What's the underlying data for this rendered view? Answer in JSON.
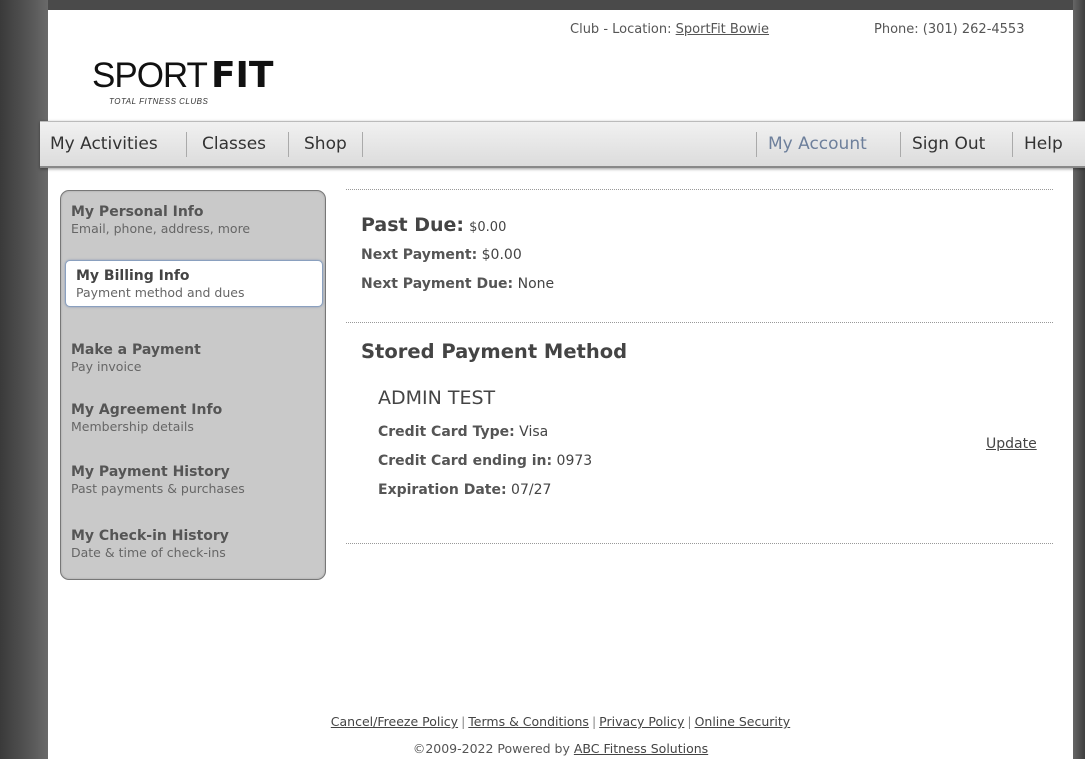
{
  "logo": {
    "word_light": "SPORT",
    "word_bold": "FIT",
    "tagline": "TOTAL FITNESS CLUBS"
  },
  "header": {
    "club_label": "Club - Location:",
    "club_name": "SportFit Bowie",
    "phone_label": "Phone:",
    "phone": "(301) 262-4553"
  },
  "nav": {
    "my_activities": "My Activities",
    "classes": "Classes",
    "shop": "Shop",
    "my_account": "My Account",
    "sign_out": "Sign Out",
    "help": "Help"
  },
  "sidebar": {
    "items": [
      {
        "title": "My Personal Info",
        "subtitle": "Email, phone, address, more"
      },
      {
        "title": "My Billing Info",
        "subtitle": "Payment method and dues"
      },
      {
        "title": "Make a Payment",
        "subtitle": "Pay invoice"
      },
      {
        "title": "My Agreement Info",
        "subtitle": "Membership details"
      },
      {
        "title": "My Payment History",
        "subtitle": "Past payments & purchases"
      },
      {
        "title": "My Check-in History",
        "subtitle": "Date & time of check-ins"
      }
    ]
  },
  "billing": {
    "past_due_label": "Past Due:",
    "past_due_value": "$0.00",
    "next_payment_label": "Next Payment:",
    "next_payment_value": "$0.00",
    "next_payment_due_label": "Next Payment Due:",
    "next_payment_due_value": "None"
  },
  "stored_payment": {
    "section_title": "Stored Payment Method",
    "holder_name": "ADMIN TEST",
    "card_type_label": "Credit Card Type:",
    "card_type_value": "Visa",
    "card_ending_label": "Credit Card ending in:",
    "card_ending_value": "0973",
    "expiration_label": "Expiration Date:",
    "expiration_value": "07/27",
    "update_link": "Update"
  },
  "footer": {
    "cancel_freeze": "Cancel/Freeze Policy",
    "terms": "Terms & Conditions",
    "privacy": "Privacy Policy",
    "security": "Online Security",
    "copyright_prefix": "©2009-2022 Powered by",
    "powered_by": "ABC Fitness Solutions"
  }
}
